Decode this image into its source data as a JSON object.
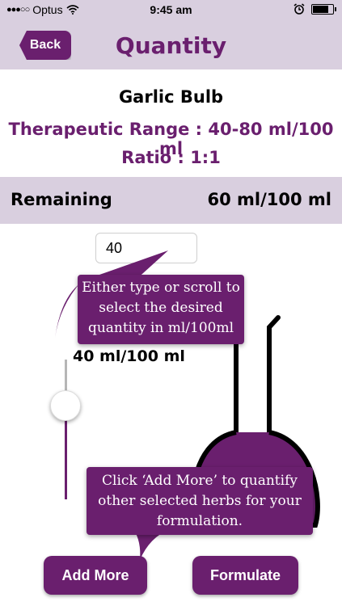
{
  "status_bar": {
    "carrier": "Optus",
    "time": "9:45 am",
    "battery_level": 0.85
  },
  "nav": {
    "back_label": "Back",
    "title": "Quantity"
  },
  "herb": {
    "name": "Garlic Bulb",
    "therapeutic_range": "Therapeutic Range : 40-80 ml/100 ml",
    "ratio": "Ratio : 1:1"
  },
  "remaining": {
    "label": "Remaining",
    "value": "60 ml/100 ml"
  },
  "quantity": {
    "input_value": "40",
    "display": "40 ml/100 ml",
    "slider_level": 0.33
  },
  "tips": {
    "scroll": "Either type or scroll to select the desired quantity in ml/100ml",
    "add_more": "Click ‘Add More’ to quantify other selected herbs for your formulation."
  },
  "buttons": {
    "add_more": "Add More",
    "formulate": "Formulate"
  },
  "colors": {
    "accent": "#6a1f6e",
    "header_bg": "#d9cfdf"
  }
}
